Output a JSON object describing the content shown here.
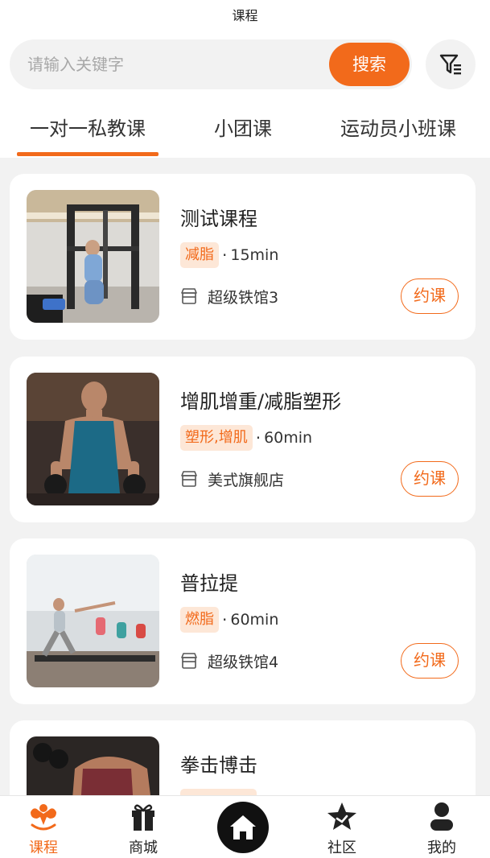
{
  "page": {
    "title": "课程"
  },
  "search": {
    "placeholder": "请输入关键字",
    "value": "",
    "button_label": "搜索"
  },
  "filter": {
    "icon": "filter-icon"
  },
  "tabs": [
    {
      "label": "一对一私教课",
      "active": true
    },
    {
      "label": "小团课",
      "active": false
    },
    {
      "label": "运动员小班课",
      "active": false
    }
  ],
  "courses": [
    {
      "name": "测试课程",
      "tags": "减脂",
      "dot": "·",
      "duration": "15min",
      "store": "超级铁馆3",
      "book_label": "约课",
      "image": "gym-machine-photo"
    },
    {
      "name": "增肌增重/减脂塑形",
      "tags": "塑形,增肌",
      "dot": "·",
      "duration": "60min",
      "store": "美式旗舰店",
      "book_label": "约课",
      "image": "dumbbell-trainer-photo"
    },
    {
      "name": "普拉提",
      "tags": "燃脂",
      "dot": "·",
      "duration": "60min",
      "store": "超级铁馆4",
      "book_label": "约课",
      "image": "pilates-class-photo"
    },
    {
      "name": "拳击博击",
      "tags": "",
      "dot": "",
      "duration": "",
      "store": "",
      "book_label": "",
      "image": "boxer-photo"
    }
  ],
  "nav": {
    "items": [
      {
        "label": "课程",
        "icon": "muscle-icon",
        "active": true
      },
      {
        "label": "商城",
        "icon": "gift-icon",
        "active": false
      },
      {
        "label": "",
        "icon": "home-icon",
        "active": false
      },
      {
        "label": "社区",
        "icon": "star-icon",
        "active": false
      },
      {
        "label": "我的",
        "icon": "user-icon",
        "active": false
      }
    ]
  },
  "colors": {
    "accent": "#f26a1b",
    "tag_bg": "#fde7d7",
    "page_bg": "#f2f2f2"
  }
}
